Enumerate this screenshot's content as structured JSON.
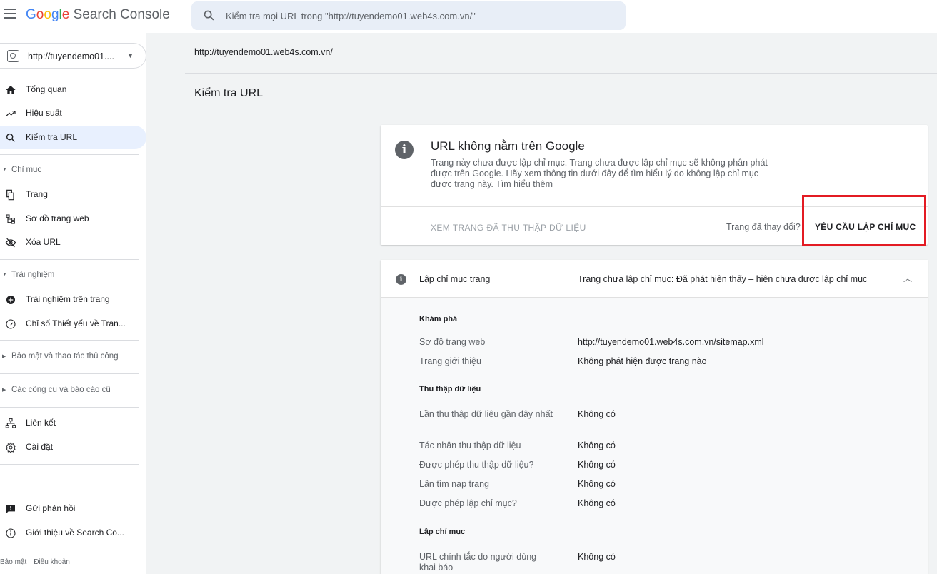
{
  "header": {
    "brand_google": [
      "G",
      "o",
      "o",
      "g",
      "l",
      "e"
    ],
    "brand_rest": "Search Console",
    "search_placeholder": "Kiểm tra mọi URL trong \"http://tuyendemo01.web4s.com.vn/\""
  },
  "sidebar": {
    "property": "http://tuyendemo01....",
    "items_top": [
      {
        "label": "Tổng quan",
        "icon": "home-icon"
      },
      {
        "label": "Hiệu suất",
        "icon": "trending-up-icon"
      },
      {
        "label": "Kiểm tra URL",
        "icon": "search-icon",
        "active": true
      }
    ],
    "section_index": "Chỉ mục",
    "items_index": [
      {
        "label": "Trang",
        "icon": "pages-icon"
      },
      {
        "label": "Sơ đồ trang web",
        "icon": "sitemap-icon"
      },
      {
        "label": "Xóa URL",
        "icon": "eye-off-icon"
      }
    ],
    "section_experience": "Trải nghiệm",
    "items_experience": [
      {
        "label": "Trải nghiệm trên trang",
        "icon": "plus-circle-icon"
      },
      {
        "label": "Chỉ số Thiết yếu về Tran...",
        "icon": "gauge-icon"
      }
    ],
    "section_security": "Bảo mật và thao tác thủ công",
    "section_legacy": "Các công cụ và báo cáo cũ",
    "items_bottom": [
      {
        "label": "Liên kết",
        "icon": "links-icon"
      },
      {
        "label": "Cài đặt",
        "icon": "gear-icon"
      }
    ],
    "items_footer": [
      {
        "label": "Gửi phản hồi",
        "icon": "feedback-icon"
      },
      {
        "label": "Giới thiệu về Search Co...",
        "icon": "info-outline-icon"
      }
    ],
    "footer_links": [
      "Bảo mật",
      "Điều khoản"
    ]
  },
  "main": {
    "breadcrumb": "http://tuyendemo01.web4s.com.vn/",
    "title": "Kiểm tra URL",
    "status_card": {
      "title": "URL không nằm trên Google",
      "description": "Trang này chưa được lập chỉ mục. Trang chưa được lập chỉ mục sẽ không phân phát được trên Google. Hãy xem thông tin dưới đây để tìm hiểu lý do không lập chỉ mục được trang này.",
      "learn_more": "Tìm hiểu thêm",
      "view_crawled": "XEM TRANG ĐÃ THU THẬP DỮ LIỆU",
      "page_changed": "Trang đã thay đổi?",
      "request_indexing": "YÊU CẦU LẬP CHỈ MỤC"
    },
    "coverage_card": {
      "label": "Lập chỉ mục trang",
      "status": "Trang chưa lập chỉ mục: Đã phát hiện thấy – hiện chưa được lập chỉ mục",
      "sections": [
        {
          "heading": "Khám phá",
          "rows": [
            {
              "k": "Sơ đồ trang web",
              "v": "http://tuyendemo01.web4s.com.vn/sitemap.xml"
            },
            {
              "k": "Trang giới thiệu",
              "v": "Không phát hiện được trang nào"
            }
          ]
        },
        {
          "heading": "Thu thập dữ liệu",
          "rows": [
            {
              "k": "Lần thu thập dữ liệu gần đây nhất",
              "v": "Không có"
            },
            {
              "k": "Tác nhân thu thập dữ liệu",
              "v": "Không có"
            },
            {
              "k": "Được phép thu thập dữ liệu?",
              "v": "Không có"
            },
            {
              "k": "Lần tìm nạp trang",
              "v": "Không có"
            },
            {
              "k": "Được phép lập chỉ mục?",
              "v": "Không có"
            }
          ]
        },
        {
          "heading": "Lập chỉ mục",
          "rows": [
            {
              "k": "URL chính tắc do người dùng khai báo",
              "v": "Không có"
            }
          ]
        }
      ]
    }
  },
  "colors": {
    "accent_active": "#e8f0fe",
    "highlight_box": "#e31b23",
    "search_bg": "#e8eef7"
  }
}
